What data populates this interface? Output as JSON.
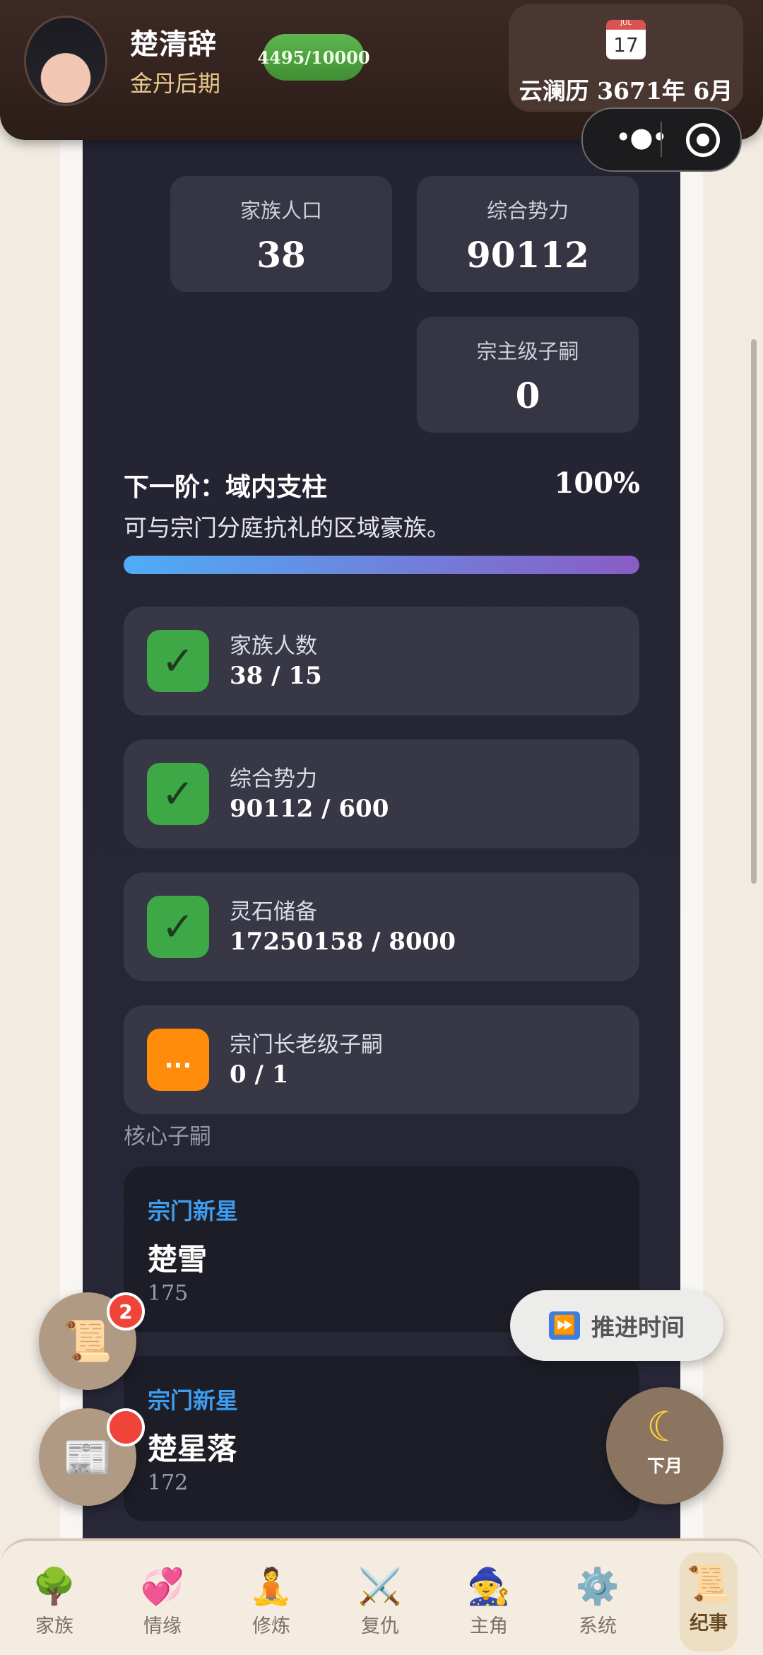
{
  "header": {
    "player_name": "楚清辞",
    "realm": "金丹后期",
    "exp": "4495/10000",
    "calendar_month": "JUL",
    "calendar_day": "17",
    "date": "云澜历 3671年 6月"
  },
  "stats": [
    {
      "label": "家族人口",
      "value": "38"
    },
    {
      "label": "综合势力",
      "value": "90112"
    },
    {
      "label": "宗主级子嗣",
      "value": "0"
    }
  ],
  "next_tier": {
    "title": "下一阶：域内支柱",
    "percent": "100%",
    "description": "可与宗门分庭抗礼的区域豪族。",
    "progress": 1.0
  },
  "requirements": [
    {
      "label": "家族人数",
      "value": "38 / 15",
      "status": "done",
      "icon": "✓"
    },
    {
      "label": "综合势力",
      "value": "90112 / 600",
      "status": "done",
      "icon": "✓"
    },
    {
      "label": "灵石储备",
      "value": "17250158 / 8000",
      "status": "done",
      "icon": "✓"
    },
    {
      "label": "宗门长老级子嗣",
      "value": "0 / 1",
      "status": "pending",
      "icon": "..."
    }
  ],
  "core_heirs_label": "核心子嗣",
  "heirs": [
    {
      "title": "宗门新星",
      "name": "楚雪",
      "value": "175"
    },
    {
      "title": "宗门新星",
      "name": "楚星落",
      "value": "172"
    }
  ],
  "floating": {
    "scroll_badge": "2",
    "advance_label": "推进时间",
    "next_month_label": "下月"
  },
  "nav": [
    {
      "label": "家族",
      "icon": "🌳"
    },
    {
      "label": "情缘",
      "icon": "💞"
    },
    {
      "label": "修炼",
      "icon": "🧘"
    },
    {
      "label": "复仇",
      "icon": "⚔️"
    },
    {
      "label": "主角",
      "icon": "🧙"
    },
    {
      "label": "系统",
      "icon": "⚙️"
    },
    {
      "label": "纪事",
      "icon": "📜"
    }
  ]
}
